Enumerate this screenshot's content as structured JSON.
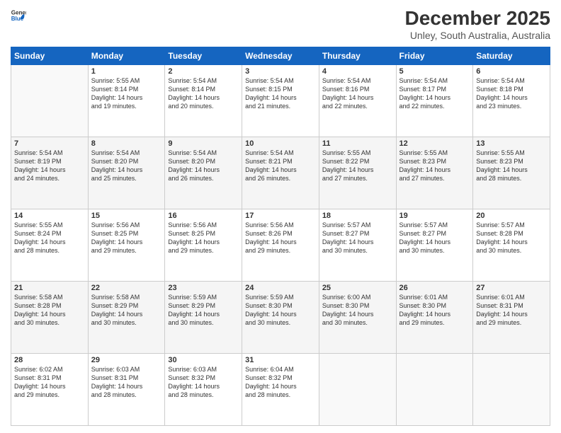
{
  "logo": {
    "line1": "General",
    "line2": "Blue"
  },
  "title": "December 2025",
  "subtitle": "Unley, South Australia, Australia",
  "weekdays": [
    "Sunday",
    "Monday",
    "Tuesday",
    "Wednesday",
    "Thursday",
    "Friday",
    "Saturday"
  ],
  "weeks": [
    [
      {
        "day": "",
        "info": ""
      },
      {
        "day": "1",
        "info": "Sunrise: 5:55 AM\nSunset: 8:14 PM\nDaylight: 14 hours\nand 19 minutes."
      },
      {
        "day": "2",
        "info": "Sunrise: 5:54 AM\nSunset: 8:14 PM\nDaylight: 14 hours\nand 20 minutes."
      },
      {
        "day": "3",
        "info": "Sunrise: 5:54 AM\nSunset: 8:15 PM\nDaylight: 14 hours\nand 21 minutes."
      },
      {
        "day": "4",
        "info": "Sunrise: 5:54 AM\nSunset: 8:16 PM\nDaylight: 14 hours\nand 22 minutes."
      },
      {
        "day": "5",
        "info": "Sunrise: 5:54 AM\nSunset: 8:17 PM\nDaylight: 14 hours\nand 22 minutes."
      },
      {
        "day": "6",
        "info": "Sunrise: 5:54 AM\nSunset: 8:18 PM\nDaylight: 14 hours\nand 23 minutes."
      }
    ],
    [
      {
        "day": "7",
        "info": "Sunrise: 5:54 AM\nSunset: 8:19 PM\nDaylight: 14 hours\nand 24 minutes."
      },
      {
        "day": "8",
        "info": "Sunrise: 5:54 AM\nSunset: 8:20 PM\nDaylight: 14 hours\nand 25 minutes."
      },
      {
        "day": "9",
        "info": "Sunrise: 5:54 AM\nSunset: 8:20 PM\nDaylight: 14 hours\nand 26 minutes."
      },
      {
        "day": "10",
        "info": "Sunrise: 5:54 AM\nSunset: 8:21 PM\nDaylight: 14 hours\nand 26 minutes."
      },
      {
        "day": "11",
        "info": "Sunrise: 5:55 AM\nSunset: 8:22 PM\nDaylight: 14 hours\nand 27 minutes."
      },
      {
        "day": "12",
        "info": "Sunrise: 5:55 AM\nSunset: 8:23 PM\nDaylight: 14 hours\nand 27 minutes."
      },
      {
        "day": "13",
        "info": "Sunrise: 5:55 AM\nSunset: 8:23 PM\nDaylight: 14 hours\nand 28 minutes."
      }
    ],
    [
      {
        "day": "14",
        "info": "Sunrise: 5:55 AM\nSunset: 8:24 PM\nDaylight: 14 hours\nand 28 minutes."
      },
      {
        "day": "15",
        "info": "Sunrise: 5:56 AM\nSunset: 8:25 PM\nDaylight: 14 hours\nand 29 minutes."
      },
      {
        "day": "16",
        "info": "Sunrise: 5:56 AM\nSunset: 8:25 PM\nDaylight: 14 hours\nand 29 minutes."
      },
      {
        "day": "17",
        "info": "Sunrise: 5:56 AM\nSunset: 8:26 PM\nDaylight: 14 hours\nand 29 minutes."
      },
      {
        "day": "18",
        "info": "Sunrise: 5:57 AM\nSunset: 8:27 PM\nDaylight: 14 hours\nand 30 minutes."
      },
      {
        "day": "19",
        "info": "Sunrise: 5:57 AM\nSunset: 8:27 PM\nDaylight: 14 hours\nand 30 minutes."
      },
      {
        "day": "20",
        "info": "Sunrise: 5:57 AM\nSunset: 8:28 PM\nDaylight: 14 hours\nand 30 minutes."
      }
    ],
    [
      {
        "day": "21",
        "info": "Sunrise: 5:58 AM\nSunset: 8:28 PM\nDaylight: 14 hours\nand 30 minutes."
      },
      {
        "day": "22",
        "info": "Sunrise: 5:58 AM\nSunset: 8:29 PM\nDaylight: 14 hours\nand 30 minutes."
      },
      {
        "day": "23",
        "info": "Sunrise: 5:59 AM\nSunset: 8:29 PM\nDaylight: 14 hours\nand 30 minutes."
      },
      {
        "day": "24",
        "info": "Sunrise: 5:59 AM\nSunset: 8:30 PM\nDaylight: 14 hours\nand 30 minutes."
      },
      {
        "day": "25",
        "info": "Sunrise: 6:00 AM\nSunset: 8:30 PM\nDaylight: 14 hours\nand 30 minutes."
      },
      {
        "day": "26",
        "info": "Sunrise: 6:01 AM\nSunset: 8:30 PM\nDaylight: 14 hours\nand 29 minutes."
      },
      {
        "day": "27",
        "info": "Sunrise: 6:01 AM\nSunset: 8:31 PM\nDaylight: 14 hours\nand 29 minutes."
      }
    ],
    [
      {
        "day": "28",
        "info": "Sunrise: 6:02 AM\nSunset: 8:31 PM\nDaylight: 14 hours\nand 29 minutes."
      },
      {
        "day": "29",
        "info": "Sunrise: 6:03 AM\nSunset: 8:31 PM\nDaylight: 14 hours\nand 28 minutes."
      },
      {
        "day": "30",
        "info": "Sunrise: 6:03 AM\nSunset: 8:32 PM\nDaylight: 14 hours\nand 28 minutes."
      },
      {
        "day": "31",
        "info": "Sunrise: 6:04 AM\nSunset: 8:32 PM\nDaylight: 14 hours\nand 28 minutes."
      },
      {
        "day": "",
        "info": ""
      },
      {
        "day": "",
        "info": ""
      },
      {
        "day": "",
        "info": ""
      }
    ]
  ]
}
